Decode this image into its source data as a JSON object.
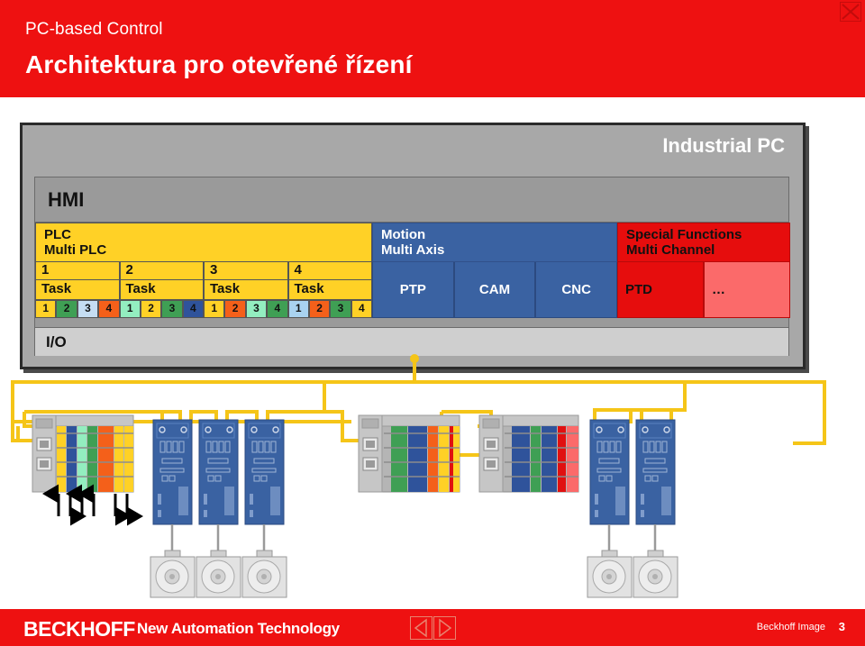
{
  "header": {
    "kicker": "PC-based Control",
    "title": "Architektura pro otevřené řízení",
    "close_icon": "close-icon"
  },
  "diagram": {
    "ipc_title": "Industrial PC",
    "hmi_label": "HMI",
    "io_label": "I/O",
    "plc": {
      "line1": "PLC",
      "line2": "Multi PLC",
      "task_numbers": [
        "1",
        "2",
        "3",
        "4"
      ],
      "task_labels": [
        "Task",
        "Task",
        "Task",
        "Task"
      ],
      "chips": [
        {
          "label": "1",
          "color": "#ffd126"
        },
        {
          "label": "2",
          "color": "#3f9f54"
        },
        {
          "label": "3",
          "color": "#c5ddf2"
        },
        {
          "label": "4",
          "color": "#f4601a"
        },
        {
          "label": "1",
          "color": "#93eec0"
        },
        {
          "label": "2",
          "color": "#ffd126"
        },
        {
          "label": "3",
          "color": "#3f9f54"
        },
        {
          "label": "4",
          "color": "#2f539b"
        },
        {
          "label": "1",
          "color": "#ffd126"
        },
        {
          "label": "2",
          "color": "#f4601a"
        },
        {
          "label": "3",
          "color": "#93eec0"
        },
        {
          "label": "4",
          "color": "#3f9f54"
        },
        {
          "label": "1",
          "color": "#a9d3f0"
        },
        {
          "label": "2",
          "color": "#f4601a"
        },
        {
          "label": "3",
          "color": "#3f9f54"
        },
        {
          "label": "4",
          "color": "#ffd126"
        }
      ]
    },
    "motion": {
      "line1": "Motion",
      "line2": "Multi Axis",
      "cells": [
        "PTP",
        "CAM",
        "CNC"
      ]
    },
    "special": {
      "line1": "Special Functions",
      "line2": "Multi Channel",
      "cells": [
        "PTD",
        "…"
      ]
    }
  },
  "hardware": {
    "bus_terminal_1_modules": [
      "#ffd126",
      "#2f539b",
      "#93eec0",
      "#3f9f54",
      "#f4601a",
      "#ffd126",
      "#ffd126"
    ],
    "bus_terminal_2_modules": [
      "#3f9f54",
      "#2f539b",
      "#f4601a",
      "#ffd126",
      "#e01010",
      "#ffd126"
    ],
    "bus_terminal_3_modules": [
      "#2f539b",
      "#3f9f54",
      "#2f539b",
      "#e01010",
      "#fb6a6a"
    ],
    "drives_left_count": 3,
    "drives_right_count": 2,
    "io_arrows": [
      "up",
      "down",
      "up",
      "up",
      "down",
      "down"
    ]
  },
  "footer": {
    "brand": "BECKHOFF",
    "brand_sub": "New Automation Technology",
    "prev_icon": "prev-arrow-icon",
    "next_icon": "next-arrow-icon",
    "caption": "Beckhoff Image",
    "page": "3"
  },
  "colors": {
    "brand_red": "#ee1111",
    "plc_yellow": "#ffd126",
    "motion_blue": "#3a62a2",
    "special_red": "#e60d0d",
    "cable_yellow": "#f5c518"
  }
}
